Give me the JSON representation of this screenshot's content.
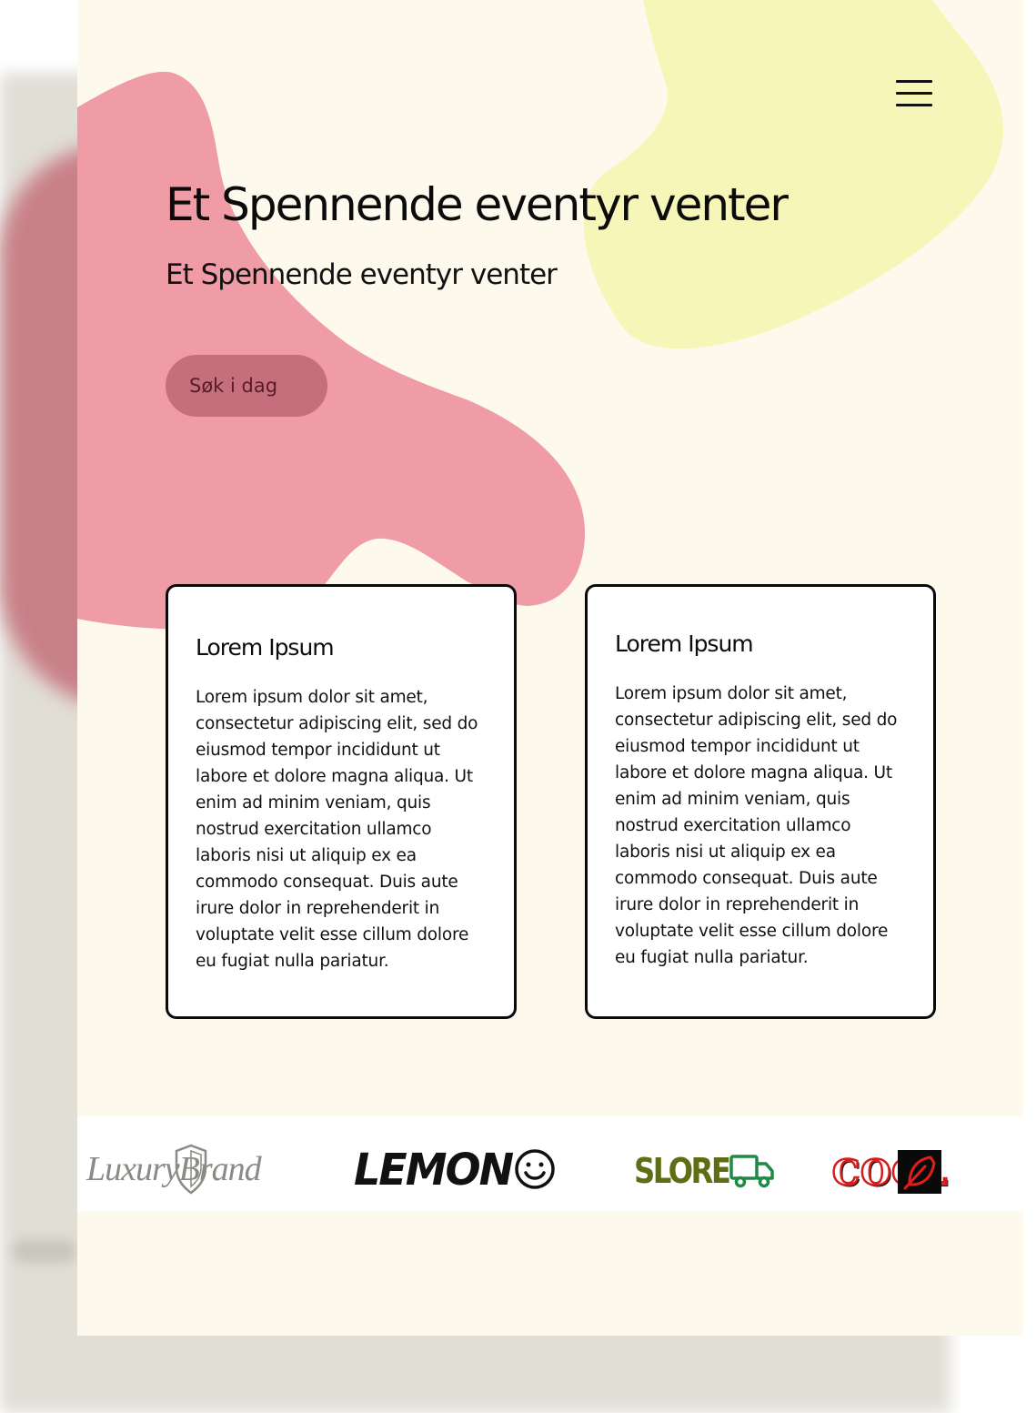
{
  "colors": {
    "page_bg": "#fdfaed",
    "pink_blob": "#f09ca6",
    "yellow_blob": "#f5f6b8",
    "button_bg": "#c56f7d",
    "button_text": "#5a1b28",
    "card_border": "#0a0a0a",
    "slore_green": "#5e6e14",
    "cool_red": "#d81b1b"
  },
  "header": {
    "menu_icon": "hamburger-menu-icon"
  },
  "hero": {
    "title": "Et Spennende eventyr venter",
    "subtitle": "Et Spennende eventyr venter",
    "cta_label": "Søk i dag"
  },
  "cards": [
    {
      "title": "Lorem Ipsum",
      "body": "Lorem ipsum dolor sit amet, consectetur adipiscing elit, sed do eiusmod tempor incididunt ut labore et dolore magna aliqua. Ut enim ad minim veniam, quis nostrud exercitation ullamco laboris nisi ut aliquip ex ea commodo consequat. Duis aute irure dolor in reprehenderit in voluptate velit esse cillum dolore eu fugiat nulla pariatur."
    },
    {
      "title": "Lorem Ipsum",
      "body": "Lorem ipsum dolor sit amet, consectetur adipiscing elit, sed do eiusmod tempor incididunt ut labore et dolore magna aliqua. Ut enim ad minim veniam, quis nostrud exercitation ullamco laboris nisi ut aliquip ex ea commodo consequat. Duis aute irure dolor in reprehenderit in voluptate velit esse cillum dolore eu fugiat nulla pariatur."
    }
  ],
  "logos": [
    {
      "text": "LuxuryBrand",
      "icon": "shield-icon"
    },
    {
      "text": "LEMON",
      "icon": "smiley-icon"
    },
    {
      "text": "SLORE",
      "icon": "truck-icon"
    },
    {
      "text": "COOL",
      "icon": "feather-icon"
    }
  ]
}
